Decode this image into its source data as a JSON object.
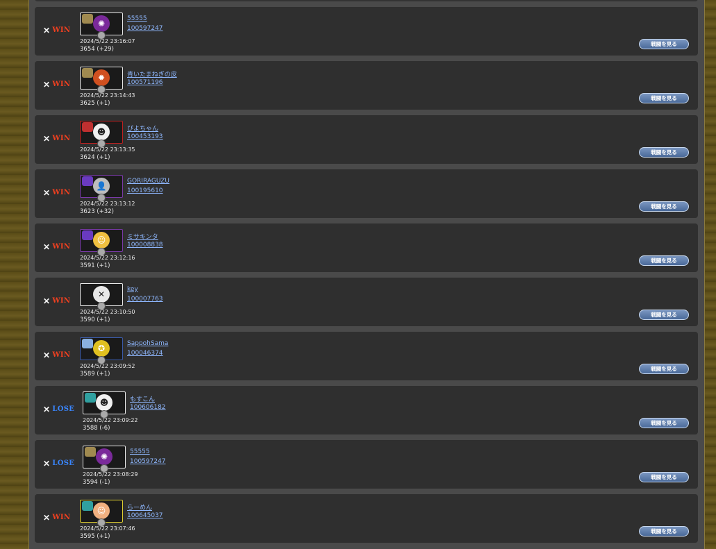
{
  "entries": [
    {
      "result": "WIN",
      "name": "55555",
      "id": "100597247",
      "datetime": "2024/5/22 23:16:07",
      "score": "3654 (+29)",
      "button": "戦闘を見る",
      "frame": "white",
      "face_color": "#7a2a9a",
      "emblem_color": "#a08a50",
      "face": "✺"
    },
    {
      "result": "WIN",
      "name": "青いたまねぎの皮",
      "id": "100571196",
      "datetime": "2024/5/22 23:14:43",
      "score": "3625 (+1)",
      "button": "戦闘を見る",
      "frame": "white",
      "face_color": "#d05020",
      "emblem_color": "#a08a50",
      "face": "✹"
    },
    {
      "result": "WIN",
      "name": "ぴよちゃん",
      "id": "100453193",
      "datetime": "2024/5/22 23:13:35",
      "score": "3624 (+1)",
      "button": "戦闘を見る",
      "frame": "red",
      "face_color": "#f0f0f0",
      "emblem_color": "#c03030",
      "face": "☻"
    },
    {
      "result": "WIN",
      "name": "GORIRAGUZU",
      "id": "100195610",
      "datetime": "2024/5/22 23:13:12",
      "score": "3623 (+32)",
      "button": "戦闘を見る",
      "frame": "purple",
      "face_color": "#bdbdbd",
      "emblem_color": "#6a3ac0",
      "face": "👤"
    },
    {
      "result": "WIN",
      "name": "ミサキンタ",
      "id": "100008838",
      "datetime": "2024/5/22 23:12:16",
      "score": "3591 (+1)",
      "button": "戦闘を見る",
      "frame": "purple",
      "face_color": "#f0c040",
      "emblem_color": "#6a3ac0",
      "face": "☺"
    },
    {
      "result": "WIN",
      "name": "key",
      "id": "100007763",
      "datetime": "2024/5/22 23:10:50",
      "score": "3590 (+1)",
      "button": "戦闘を見る",
      "frame": "white",
      "face_color": "#e8e8e8",
      "emblem_color": "#1a1a1a",
      "face": "✕"
    },
    {
      "result": "WIN",
      "name": "SappohSama",
      "id": "100046374",
      "datetime": "2024/5/22 23:09:52",
      "score": "3589 (+1)",
      "button": "戦闘を見る",
      "frame": "blue",
      "face_color": "#e0c020",
      "emblem_color": "#8ab0e0",
      "face": "✪"
    },
    {
      "result": "LOSE",
      "name": "もすこん",
      "id": "100606182",
      "datetime": "2024/5/22 23:09:22",
      "score": "3588 (-6)",
      "button": "戦闘を見る",
      "frame": "white",
      "face_color": "#f0f0f0",
      "emblem_color": "#30a0a0",
      "face": "☻"
    },
    {
      "result": "LOSE",
      "name": "55555",
      "id": "100597247",
      "datetime": "2024/5/22 23:08:29",
      "score": "3594 (-1)",
      "button": "戦闘を見る",
      "frame": "white",
      "face_color": "#7a2a9a",
      "emblem_color": "#a08a50",
      "face": "✺"
    },
    {
      "result": "WIN",
      "name": "らーめん",
      "id": "100645037",
      "datetime": "2024/5/22 23:07:46",
      "score": "3595 (+1)",
      "button": "戦闘を見る",
      "frame": "yellow",
      "face_color": "#f0b080",
      "emblem_color": "#30a0a0",
      "face": "☺"
    }
  ],
  "colors": {
    "win": "#f04020",
    "lose": "#3a86ff",
    "link": "#8fb8ff",
    "row_bg": "#2f2f2f"
  }
}
